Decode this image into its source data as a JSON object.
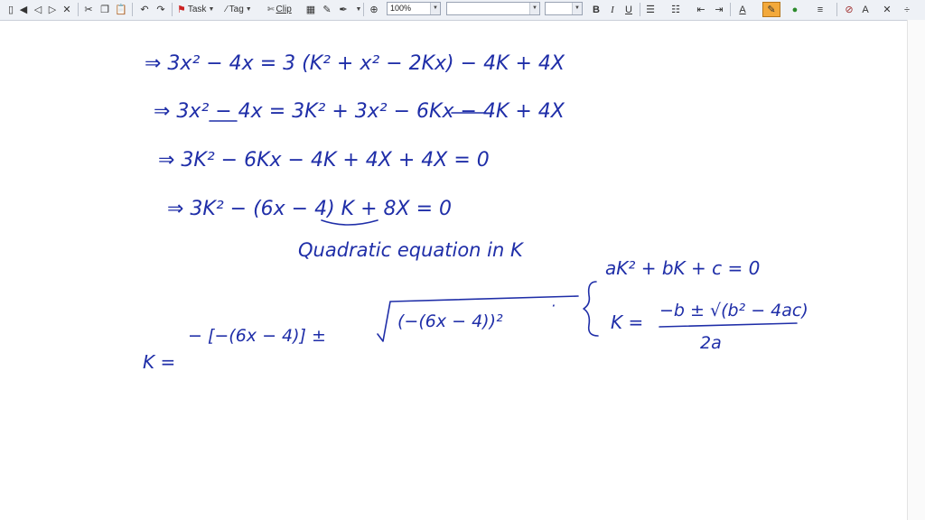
{
  "toolbar": {
    "task_label": "Task",
    "tag_label": "Tag",
    "clip_label": "Clip",
    "zoom_value": "100%",
    "font_name_value": "",
    "font_size_value": ""
  },
  "handwriting": {
    "line1": "⇒  3x² − 4x = 3 (K² + x² − 2Kx) − 4K + 4X",
    "line2": "⇒  3x² − 4x = 3K² + 3x² − 6Kx − 4K + 4X",
    "line3": "⇒  3K² − 6Kx − 4K + 4X + 4X = 0",
    "line4": "⇒  3K² − (6x − 4) K + 8X = 0",
    "note": "Quadratic equation in K",
    "formula1": "aK² + bK + c = 0",
    "formula2_lhs": "K =",
    "formula2_num": "−b ± √(b² − 4ac)",
    "formula2_den": "2a",
    "k_label": "K =",
    "numerator_left": "− [−(6x − 4)]  ±",
    "numerator_right": "(−(6x − 4))²",
    "dot": "·"
  },
  "colors": {
    "ink": "#1f2ea8",
    "toolbar_bg": "#eef1f6"
  }
}
